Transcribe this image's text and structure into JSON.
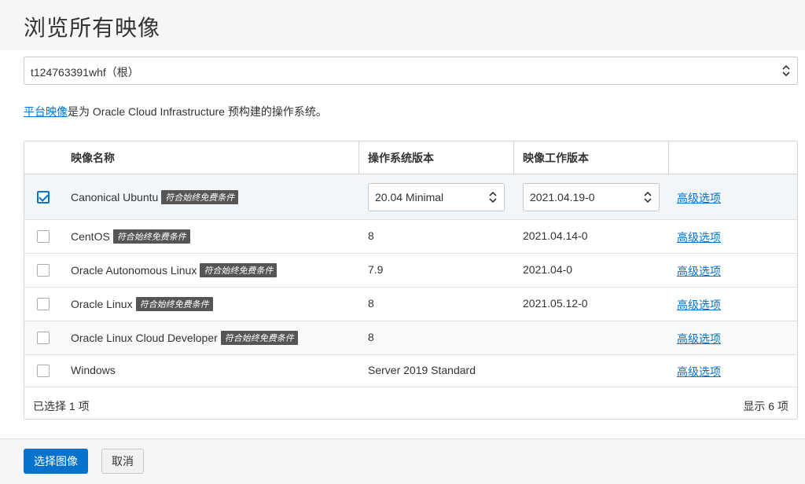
{
  "page": {
    "title": "浏览所有映像"
  },
  "compartment": {
    "value": "t124763391whf（根）"
  },
  "description": {
    "link_text": "平台映像",
    "text": "是为 Oracle Cloud Infrastructure 预构建的操作系统。"
  },
  "table": {
    "headers": {
      "name": "映像名称",
      "os_version": "操作系统版本",
      "build": "映像工作版本"
    },
    "badge_text": "符合始终免费条件",
    "advanced_label": "高级选项",
    "rows": [
      {
        "name": "Canonical Ubuntu",
        "os_version": "20.04 Minimal",
        "build": "2021.04.19-0",
        "checked": true,
        "badge": true
      },
      {
        "name": "CentOS",
        "os_version": "8",
        "build": "2021.04.14-0",
        "checked": false,
        "badge": true
      },
      {
        "name": "Oracle Autonomous Linux",
        "os_version": "7.9",
        "build": "2021.04-0",
        "checked": false,
        "badge": true
      },
      {
        "name": "Oracle Linux",
        "os_version": "8",
        "build": "2021.05.12-0",
        "checked": false,
        "badge": true
      },
      {
        "name": "Oracle Linux Cloud Developer",
        "os_version": "8",
        "build": "",
        "checked": false,
        "badge": true
      },
      {
        "name": "Windows",
        "os_version": "Server 2019 Standard",
        "build": "",
        "checked": false,
        "badge": false
      }
    ],
    "footer": {
      "selected": "已选择 1 项",
      "shown": "显示 6 项"
    }
  },
  "buttons": {
    "select": "选择图像",
    "cancel": "取消"
  },
  "colors": {
    "accent": "#0572ce",
    "badge_bg": "#555555",
    "selected_row": "#f1f6fb"
  }
}
